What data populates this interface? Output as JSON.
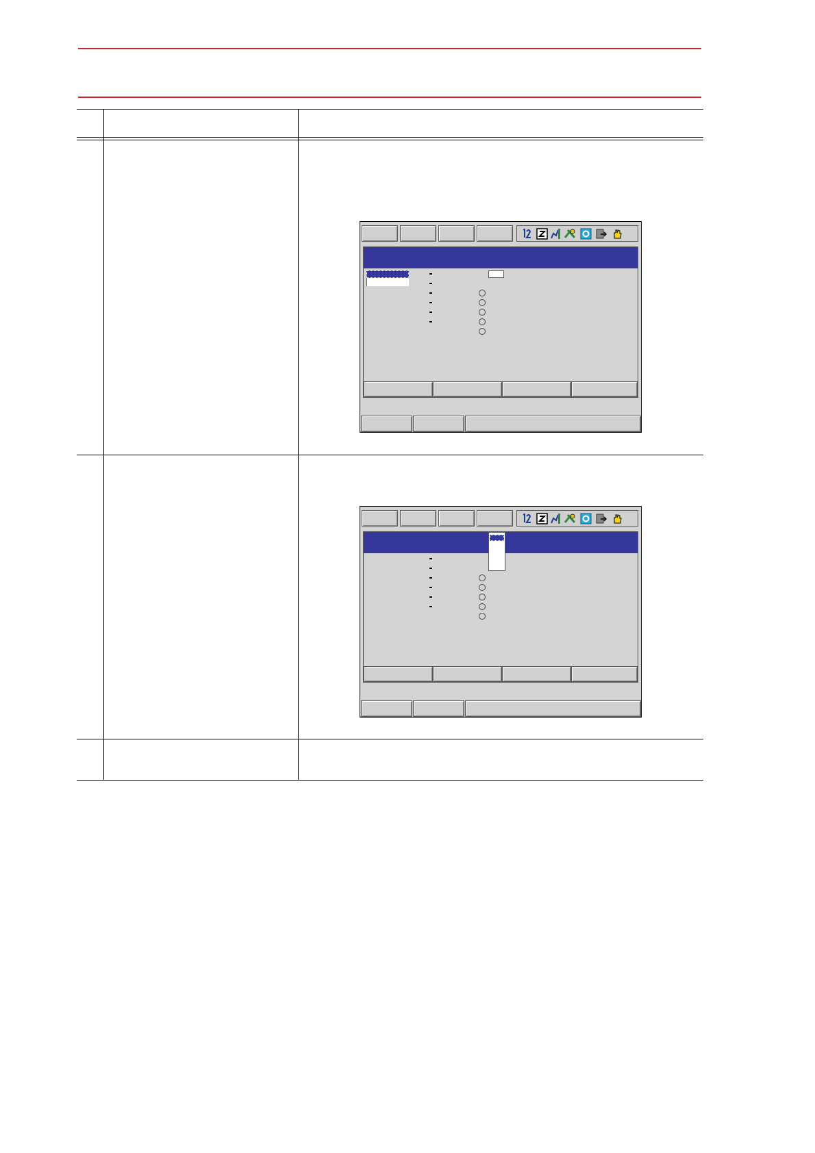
{
  "document": {
    "header_rules": {
      "color": "#c8282c"
    }
  },
  "table": {
    "rows": [
      {
        "row_id": "step-a",
        "has_screen": true,
        "screen": "screen-1"
      },
      {
        "row_id": "step-b",
        "has_screen": true,
        "screen": "screen-2"
      },
      {
        "row_id": "step-c",
        "has_screen": false
      }
    ]
  },
  "pendant": {
    "title_bar_color": "#35379a",
    "status_icons": [
      "one-two-icon",
      "z-box-icon",
      "robot-arm-icon",
      "tools-icon",
      "cycle-icon",
      "export-icon",
      "hand-icon"
    ],
    "screen_1": {
      "list_selection": "highlighted",
      "dropdown_open": false
    },
    "screen_2": {
      "list_selection": "none",
      "dropdown_open": true
    }
  }
}
